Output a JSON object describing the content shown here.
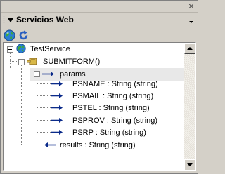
{
  "window": {
    "close_glyph": "×"
  },
  "panel": {
    "title": "Servicios Web",
    "collapse_icon": "triangle-down-icon",
    "options_icon": "panel-options-menu-icon"
  },
  "toolbar": {
    "buttons": [
      {
        "name": "web-service-globe-icon"
      },
      {
        "name": "refresh-icon"
      }
    ]
  },
  "tree": {
    "service": {
      "label": "TestService",
      "icon": "globe-icon"
    },
    "method": {
      "label": "SUBMITFORM()",
      "icon": "method-block-icon"
    },
    "params": {
      "label": "params",
      "icon": "arrow-right-icon"
    },
    "param_items": [
      {
        "label": "PSNAME : String (string)"
      },
      {
        "label": "PSMAIL : String (string)"
      },
      {
        "label": "PSTEL : String (string)"
      },
      {
        "label": "PSPROV : String (string)"
      },
      {
        "label": "PSRP : String (string)"
      }
    ],
    "results": {
      "label": "results : String (string)",
      "icon": "arrow-left-icon"
    }
  },
  "colors": {
    "panel_bg": "#d4d0c8",
    "arrow_blue": "#0a2a8a",
    "selected_bg": "#e8e8e8"
  }
}
